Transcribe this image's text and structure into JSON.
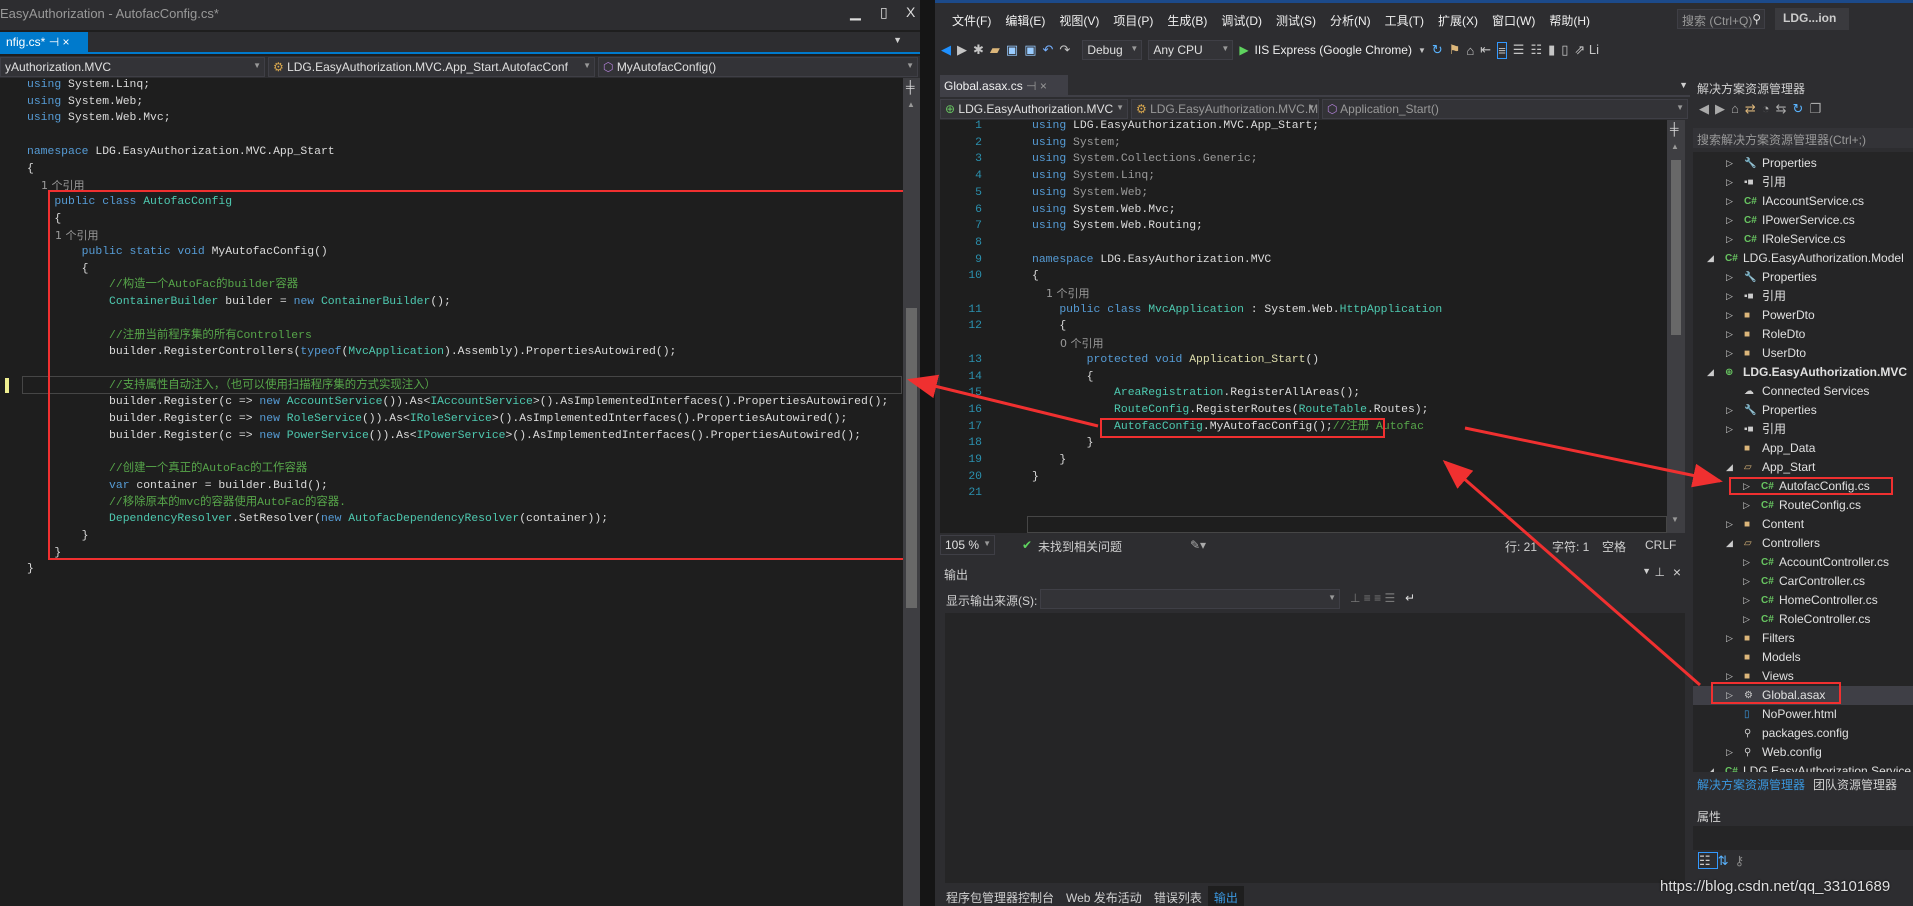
{
  "left": {
    "title": "EasyAuthorization - AutofacConfig.cs*",
    "tab": "nfig.cs*",
    "nav": [
      "yAuthorization.MVC",
      "LDG.EasyAuthorization.MVC.App_Start.AutofacConf",
      "MyAutofacConfig()"
    ],
    "code": [
      [
        [
          "k",
          "using"
        ],
        [
          "p",
          " System.Linq;"
        ]
      ],
      [
        [
          "k",
          "using"
        ],
        [
          "p",
          " System.Web;"
        ]
      ],
      [
        [
          "k",
          "using"
        ],
        [
          "p",
          " System.Web.Mvc;"
        ]
      ],
      [],
      [
        [
          "k",
          "namespace"
        ],
        [
          "p",
          " LDG.EasyAuthorization.MVC.App_Start"
        ]
      ],
      [
        [
          "p",
          "{"
        ]
      ],
      [
        [
          "l",
          "    1 个引用"
        ]
      ],
      [
        [
          "k",
          "    public class "
        ],
        [
          "t",
          "AutofacConfig"
        ]
      ],
      [
        [
          "p",
          "    {"
        ]
      ],
      [
        [
          "l",
          "        1 个引用"
        ]
      ],
      [
        [
          "k",
          "        public static void "
        ],
        [
          "p",
          "MyAutofacConfig()"
        ]
      ],
      [
        [
          "p",
          "        {"
        ]
      ],
      [
        [
          "c",
          "            //构造一个AutoFac的builder容器"
        ]
      ],
      [
        [
          "t",
          "            ContainerBuilder"
        ],
        [
          "p",
          " builder = "
        ],
        [
          "k",
          "new "
        ],
        [
          "t",
          "ContainerBuilder"
        ],
        [
          "p",
          "();"
        ]
      ],
      [],
      [
        [
          "c",
          "            //注册当前程序集的所有Controllers"
        ]
      ],
      [
        [
          "p",
          "            builder.RegisterControllers("
        ],
        [
          "k",
          "typeof"
        ],
        [
          "p",
          "("
        ],
        [
          "t",
          "MvcApplication"
        ],
        [
          "p",
          ").Assembly).PropertiesAutowired();"
        ]
      ],
      [],
      [
        [
          "c",
          "            //支持属性自动注入，（也可以使用扫描程序集的方式实现注入）"
        ]
      ],
      [
        [
          "p",
          "            builder.Register(c => "
        ],
        [
          "k",
          "new "
        ],
        [
          "t",
          "AccountService"
        ],
        [
          "p",
          "()).As<"
        ],
        [
          "t",
          "IAccountService"
        ],
        [
          "p",
          ">().AsImplementedInterfaces().PropertiesAutowired();"
        ]
      ],
      [
        [
          "p",
          "            builder.Register(c => "
        ],
        [
          "k",
          "new "
        ],
        [
          "t",
          "RoleService"
        ],
        [
          "p",
          "()).As<"
        ],
        [
          "t",
          "IRoleService"
        ],
        [
          "p",
          ">().AsImplementedInterfaces().PropertiesAutowired();"
        ]
      ],
      [
        [
          "p",
          "            builder.Register(c => "
        ],
        [
          "k",
          "new "
        ],
        [
          "t",
          "PowerService"
        ],
        [
          "p",
          "()).As<"
        ],
        [
          "t",
          "IPowerService"
        ],
        [
          "p",
          ">().AsImplementedInterfaces().PropertiesAutowired();"
        ]
      ],
      [],
      [
        [
          "c",
          "            //创建一个真正的AutoFac的工作容器"
        ]
      ],
      [
        [
          "k",
          "            var"
        ],
        [
          "p",
          " container = builder.Build();"
        ]
      ],
      [
        [
          "c",
          "            //移除原本的mvc的容器使用AutoFac的容器."
        ]
      ],
      [
        [
          "t",
          "            DependencyResolver"
        ],
        [
          "p",
          ".SetResolver("
        ],
        [
          "k",
          "new "
        ],
        [
          "t",
          "AutofacDependencyResolver"
        ],
        [
          "p",
          "(container));"
        ]
      ],
      [
        [
          "p",
          "        }"
        ]
      ],
      [
        [
          "p",
          "    }"
        ]
      ],
      [
        [
          "p",
          "}"
        ]
      ]
    ]
  },
  "right": {
    "menu": [
      "文件(F)",
      "编辑(E)",
      "视图(V)",
      "项目(P)",
      "生成(B)",
      "调试(D)",
      "测试(S)",
      "分析(N)",
      "工具(T)",
      "扩展(X)",
      "窗口(W)",
      "帮助(H)"
    ],
    "search_placeholder": "搜索 (Ctrl+Q)",
    "solution_badge": "LDG...ion",
    "config": "Debug",
    "platform": "Any CPU",
    "run": "IIS Express (Google Chrome)",
    "toolbar_extra": "Li",
    "tab": "Global.asax.cs",
    "nav": [
      "LDG.EasyAuthorization.MVC",
      "LDG.EasyAuthorization.MVC.MvcApp",
      "Application_Start()"
    ],
    "code": [
      {
        "n": "1",
        "t": [
          [
            "k",
            "using"
          ],
          [
            "p",
            " LDG.EasyAuthorization.MVC.App_Start;"
          ]
        ]
      },
      {
        "n": "2",
        "t": [
          [
            "k",
            "using"
          ],
          [
            "g",
            " System;"
          ]
        ]
      },
      {
        "n": "3",
        "t": [
          [
            "k",
            "using"
          ],
          [
            "g",
            " System.Collections.Generic;"
          ]
        ]
      },
      {
        "n": "4",
        "t": [
          [
            "k",
            "using"
          ],
          [
            "g",
            " System.Linq;"
          ]
        ]
      },
      {
        "n": "5",
        "t": [
          [
            "k",
            "using"
          ],
          [
            "g",
            " System.Web;"
          ]
        ]
      },
      {
        "n": "6",
        "t": [
          [
            "k",
            "using"
          ],
          [
            "p",
            " System.Web.Mvc;"
          ]
        ]
      },
      {
        "n": "7",
        "t": [
          [
            "k",
            "using"
          ],
          [
            "p",
            " System.Web.Routing;"
          ]
        ]
      },
      {
        "n": "8",
        "t": []
      },
      {
        "n": "9",
        "t": [
          [
            "k",
            "namespace"
          ],
          [
            "p",
            " LDG.EasyAuthorization.MVC"
          ]
        ]
      },
      {
        "n": "10",
        "t": [
          [
            "p",
            "{"
          ]
        ]
      },
      {
        "n": "",
        "t": [
          [
            "l",
            "    1 个引用"
          ]
        ]
      },
      {
        "n": "11",
        "t": [
          [
            "k",
            "    public class "
          ],
          [
            "t",
            "MvcApplication"
          ],
          [
            "p",
            " : System.Web."
          ],
          [
            "t",
            "HttpApplication"
          ]
        ]
      },
      {
        "n": "12",
        "t": [
          [
            "p",
            "    {"
          ]
        ]
      },
      {
        "n": "",
        "t": [
          [
            "l",
            "        0 个引用"
          ]
        ]
      },
      {
        "n": "13",
        "t": [
          [
            "k",
            "        protected void "
          ],
          [
            "y",
            "Application_Start"
          ],
          [
            "p",
            "()"
          ]
        ]
      },
      {
        "n": "14",
        "t": [
          [
            "p",
            "        {"
          ]
        ]
      },
      {
        "n": "15",
        "t": [
          [
            "t",
            "            AreaRegistration"
          ],
          [
            "p",
            ".RegisterAllAreas();"
          ]
        ]
      },
      {
        "n": "16",
        "t": [
          [
            "t",
            "            RouteConfig"
          ],
          [
            "p",
            ".RegisterRoutes("
          ],
          [
            "t",
            "RouteTable"
          ],
          [
            "p",
            ".Routes);"
          ]
        ]
      },
      {
        "n": "17",
        "t": [
          [
            "t",
            "            AutofacConfig"
          ],
          [
            "p",
            ".MyAutofacConfig();"
          ],
          [
            "c",
            "//注册 Autofac"
          ]
        ]
      },
      {
        "n": "18",
        "t": [
          [
            "p",
            "        }"
          ]
        ]
      },
      {
        "n": "19",
        "t": [
          [
            "p",
            "    }"
          ]
        ]
      },
      {
        "n": "20",
        "t": [
          [
            "p",
            "}"
          ]
        ]
      },
      {
        "n": "21",
        "t": []
      }
    ],
    "status": {
      "zoom": "105 %",
      "issues": "未找到相关问题",
      "line": "行: 21",
      "char": "字符: 1",
      "spaces": "空格",
      "eol": "CRLF"
    },
    "output": {
      "title": "输出",
      "source_label": "显示输出来源(S):",
      "source_value": ""
    },
    "bottom_tabs": [
      "程序包管理器控制台",
      "Web 发布活动",
      "错误列表",
      "输出"
    ],
    "solution_explorer": {
      "title": "解决方案资源管理器",
      "search_placeholder": "搜索解决方案资源管理器(Ctrl+;)",
      "items": [
        {
          "label": "Properties",
          "level": 2,
          "icon": "wrench",
          "exp": "right"
        },
        {
          "label": "引用",
          "level": 2,
          "icon": "references",
          "exp": "right"
        },
        {
          "label": "IAccountService.cs",
          "level": 2,
          "icon": "csharp",
          "exp": "right"
        },
        {
          "label": "IPowerService.cs",
          "level": 2,
          "icon": "csharp",
          "exp": "right"
        },
        {
          "label": "IRoleService.cs",
          "level": 2,
          "icon": "csharp",
          "exp": "right"
        },
        {
          "label": "LDG.EasyAuthorization.Model",
          "level": 1,
          "icon": "csproj",
          "exp": "down"
        },
        {
          "label": "Properties",
          "level": 2,
          "icon": "wrench",
          "exp": "right"
        },
        {
          "label": "引用",
          "level": 2,
          "icon": "references",
          "exp": "right"
        },
        {
          "label": "PowerDto",
          "level": 2,
          "icon": "folder",
          "exp": "right"
        },
        {
          "label": "RoleDto",
          "level": 2,
          "icon": "folder",
          "exp": "right"
        },
        {
          "label": "UserDto",
          "level": 2,
          "icon": "folder",
          "exp": "right"
        },
        {
          "label": "LDG.EasyAuthorization.MVC",
          "level": 1,
          "icon": "webproj",
          "exp": "down",
          "bold": true
        },
        {
          "label": "Connected Services",
          "level": 2,
          "icon": "cloud",
          "exp": ""
        },
        {
          "label": "Properties",
          "level": 2,
          "icon": "wrench",
          "exp": "right"
        },
        {
          "label": "引用",
          "level": 2,
          "icon": "references",
          "exp": "right"
        },
        {
          "label": "App_Data",
          "level": 2,
          "icon": "folder",
          "exp": ""
        },
        {
          "label": "App_Start",
          "level": 2,
          "icon": "folder-open",
          "exp": "down"
        },
        {
          "label": "AutofacConfig.cs",
          "level": 3,
          "icon": "csharp",
          "exp": "right"
        },
        {
          "label": "RouteConfig.cs",
          "level": 3,
          "icon": "csharp",
          "exp": "right"
        },
        {
          "label": "Content",
          "level": 2,
          "icon": "folder",
          "exp": "right"
        },
        {
          "label": "Controllers",
          "level": 2,
          "icon": "folder-open",
          "exp": "down"
        },
        {
          "label": "AccountController.cs",
          "level": 3,
          "icon": "csharp",
          "exp": "right"
        },
        {
          "label": "CarController.cs",
          "level": 3,
          "icon": "csharp",
          "exp": "right"
        },
        {
          "label": "HomeController.cs",
          "level": 3,
          "icon": "csharp",
          "exp": "right"
        },
        {
          "label": "RoleController.cs",
          "level": 3,
          "icon": "csharp",
          "exp": "right"
        },
        {
          "label": "Filters",
          "level": 2,
          "icon": "folder",
          "exp": "right"
        },
        {
          "label": "Models",
          "level": 2,
          "icon": "folder",
          "exp": ""
        },
        {
          "label": "Views",
          "level": 2,
          "icon": "folder",
          "exp": "right"
        },
        {
          "label": "Global.asax",
          "level": 2,
          "icon": "asax",
          "exp": "right",
          "selected": true
        },
        {
          "label": "NoPower.html",
          "level": 2,
          "icon": "html",
          "exp": ""
        },
        {
          "label": "packages.config",
          "level": 2,
          "icon": "config",
          "exp": ""
        },
        {
          "label": "Web.config",
          "level": 2,
          "icon": "config",
          "exp": "right"
        },
        {
          "label": "LDG.EasyAuthorization.Service",
          "level": 1,
          "icon": "csproj",
          "exp": "down"
        }
      ],
      "tabs": [
        "解决方案资源管理器",
        "团队资源管理器"
      ]
    },
    "properties": {
      "title": "属性"
    }
  },
  "watermark": "https://blog.csdn.net/qq_33101689",
  "colors": {
    "accent": "#007acc",
    "annotation": "#f03030",
    "keyword": "#569cd6",
    "type": "#4ec9b0",
    "comment": "#57a64a"
  }
}
